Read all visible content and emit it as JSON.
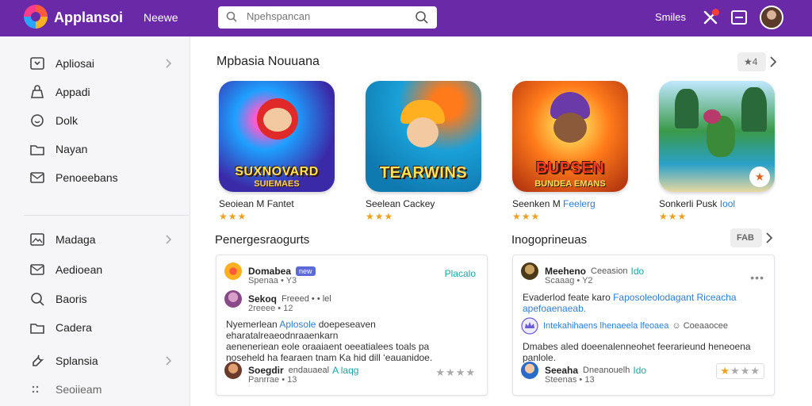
{
  "header": {
    "app_name": "Applansoi",
    "nav_link": "Neewe",
    "search": {
      "placeholder": "Npehspancan"
    },
    "right_label": "Smiles",
    "colors": {
      "brand": "#6a2aa8",
      "notification": "#ff3b3b"
    }
  },
  "sidebar": {
    "items": [
      {
        "label": "Apliosai",
        "icon": "window-icon",
        "chevron": true
      },
      {
        "label": "Appadi",
        "icon": "bag-icon",
        "chevron": false
      },
      {
        "label": "Dolk",
        "icon": "smile-icon",
        "chevron": false
      },
      {
        "label": "Nayan",
        "icon": "folder-icon",
        "chevron": false
      },
      {
        "label": "Penoeebans",
        "icon": "mail-icon",
        "chevron": false
      }
    ],
    "items2": [
      {
        "label": "Madaga",
        "icon": "image-icon",
        "chevron": true
      },
      {
        "label": "Aedioean",
        "icon": "mail-icon",
        "chevron": false
      },
      {
        "label": "Baoris",
        "icon": "search-icon",
        "chevron": false
      },
      {
        "label": "Cadera",
        "icon": "folder-icon",
        "chevron": false
      },
      {
        "label": "Splansia",
        "icon": "wrench-icon",
        "chevron": true
      },
      {
        "label": "Seoiieam",
        "icon": "dots-icon",
        "chevron": false
      }
    ]
  },
  "featured": {
    "title": "Mpbasia Nouuana",
    "pill_icon": "★",
    "pill_count": "4",
    "games": [
      {
        "tile_title": "SUXNOVARD",
        "tile_sub": "SUIEMAES",
        "name": "Seoiean M",
        "name_accent": "Fantet",
        "stars": "★★★",
        "colors": [
          "#3b2aa8",
          "#1ea0ff",
          "#ff3cd8"
        ]
      },
      {
        "tile_title": "TEARWINS",
        "tile_sub": "",
        "name": "Seelean",
        "name_accent": "Cackey",
        "stars": "★★★",
        "colors": [
          "#1aa0d8",
          "#ffb020",
          "#ff7a1a"
        ]
      },
      {
        "tile_title": "BUPSEN",
        "tile_sub": "BUNDEA EMANS",
        "name": "Seenken M",
        "name_accent": "Feelerg",
        "stars": "★★★",
        "colors": [
          "#ff7a1a",
          "#ffb020",
          "#6a3aa8"
        ]
      },
      {
        "tile_title": "",
        "tile_sub": "",
        "name": "Sonkerli",
        "name_accent": "Pusk",
        "name_accent2": "Iool",
        "stars": "★★★",
        "badge": "★",
        "colors": [
          "#3a9a4a",
          "#7ad0ff",
          "#2a6a3a"
        ]
      }
    ]
  },
  "reviews_left": {
    "title": "Penergesraogurts",
    "author": "Domabea",
    "tag": "new",
    "author_sub": "Spenaa • Y3",
    "status": "Placalo",
    "reply_name": "Sekoq",
    "reply_meta": "Freeed • • lel",
    "reply_sub": "2reeee • 12",
    "body_l1_pre": "Nyemerlean",
    "body_l1_link": "Aplosole",
    "body_l1_post": "doepeseaven eharatalreaeodnraaenkarn",
    "body_l2": "aeneneriean eole oraaiaent oeeatialees toals pa",
    "body_l3": "noseheld ha fearaen tnam Ka hid dill ‘eauanidoe.",
    "footer_name": "Soegdir",
    "footer_meta": "endauaeal",
    "footer_link": "A laqg",
    "footer_sub": "Panrrae • 13",
    "stars_on": 0,
    "stars_total": 4
  },
  "reviews_right": {
    "title": "Inogoprineuas",
    "pill_icon": "FAB",
    "author": "Meeheno",
    "author_meta": "Ceeasion",
    "author_link": "Ido",
    "author_sub": "Scaaag • Y2",
    "more": "•••",
    "body_l1_pre": "Evaderlod feate karo",
    "body_l1_link": "Faposoleolodagant Riceacha",
    "body_l2": "apefoaenaeab.",
    "link_row": "Intekahihaens lhenaeela lfeoaea",
    "link_row_tail": "☺ Coeaaocee",
    "body_l3": "Dmabes aled doeenalenneohet feerarieund heneoena panlole.",
    "footer_name": "Seeaha",
    "footer_meta": "Dneanouelh",
    "footer_link": "Ido",
    "footer_sub": "Steenas • 13",
    "stars_on": 1,
    "stars_total": 4
  }
}
